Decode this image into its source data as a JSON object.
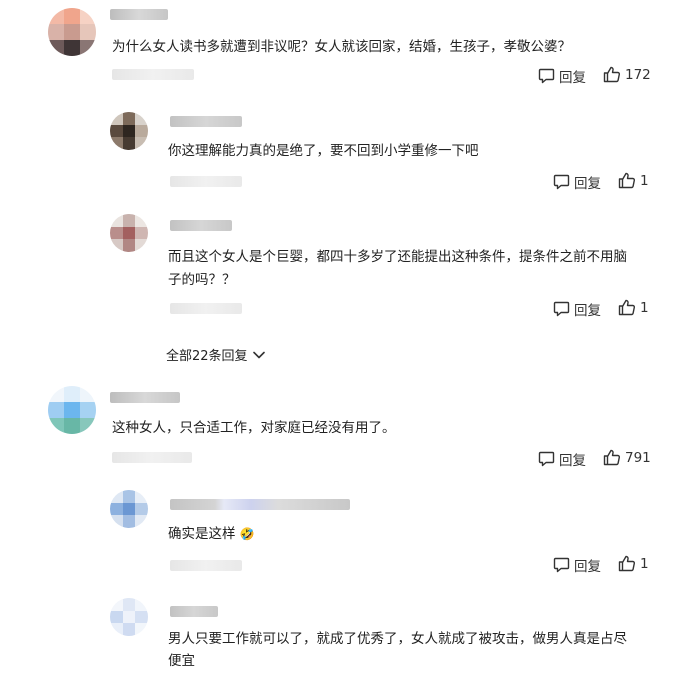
{
  "comments": [
    {
      "text": "为什么女人读书多就遭到非议呢？女人就该回家，结婚，生孩子，孝敬公婆？",
      "reply_label": "回复",
      "like_count": "172"
    },
    {
      "text": "你这理解能力真的是绝了，要不回到小学重修一下吧",
      "reply_label": "回复",
      "like_count": "1"
    },
    {
      "text_line1": "而且这个女人是个巨婴，都四十多岁了还能提出这种条件，提条件之前不用脑",
      "text_line2": "子的吗？？",
      "reply_label": "回复",
      "like_count": "1"
    },
    {
      "more_replies": "全部22条回复"
    },
    {
      "text": "这种女人，只合适工作，对家庭已经没有用了。",
      "reply_label": "回复",
      "like_count": "791"
    },
    {
      "text": "确实是这样",
      "emoji": "🤣",
      "reply_label": "回复",
      "like_count": "1"
    },
    {
      "text_line1": "男人只要工作就可以了，就成了优秀了，女人就成了被攻击，做男人真是占尽",
      "text_line2": "便宜"
    }
  ],
  "icons": {
    "reply": "comment-bubble-icon",
    "like": "thumbs-up-icon",
    "expand": "chevron-down-icon"
  }
}
